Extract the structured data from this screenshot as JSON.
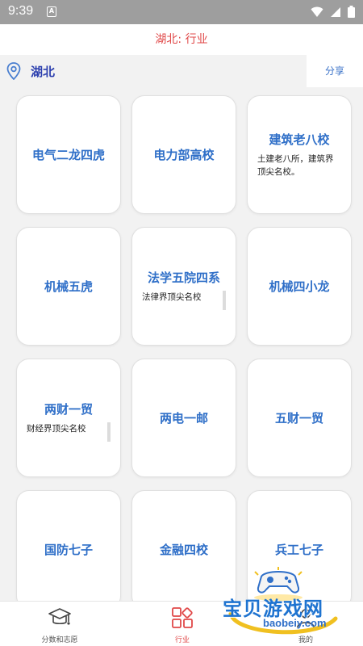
{
  "status": {
    "time": "9:39",
    "noti_letter": "A"
  },
  "header": {
    "title": "湖北: 行业"
  },
  "location": {
    "province": "湖北",
    "share_label": "分享"
  },
  "cards": [
    {
      "title": "电气二龙四虎",
      "desc": ""
    },
    {
      "title": "电力部高校",
      "desc": ""
    },
    {
      "title": "建筑老八校",
      "desc": "土建老八所，建筑界顶尖名校。"
    },
    {
      "title": "机械五虎",
      "desc": ""
    },
    {
      "title": "法学五院四系",
      "desc": "法律界顶尖名校"
    },
    {
      "title": "机械四小龙",
      "desc": ""
    },
    {
      "title": "两财一贸",
      "desc": "财经界顶尖名校"
    },
    {
      "title": "两电一邮",
      "desc": ""
    },
    {
      "title": "五财一贸",
      "desc": ""
    },
    {
      "title": "国防七子",
      "desc": ""
    },
    {
      "title": "金融四校",
      "desc": ""
    },
    {
      "title": "兵工七子",
      "desc": ""
    }
  ],
  "nav": {
    "items": [
      {
        "label": "分数和志愿",
        "icon": "graduation-cap-icon"
      },
      {
        "label": "行业",
        "icon": "grid-icon"
      },
      {
        "label": "我的",
        "icon": "person-icon"
      }
    ],
    "active_color": "#e04848"
  },
  "watermark": {
    "title": "宝贝游戏网",
    "url": "baobeiy.com"
  }
}
